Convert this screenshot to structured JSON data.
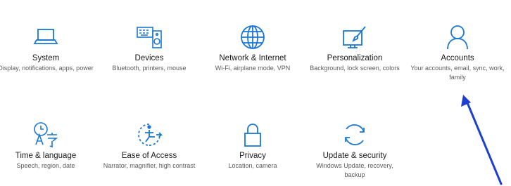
{
  "accent_color": "#1a78d2",
  "annotation_color": "#1f3fd0",
  "tiles": [
    {
      "icon": "laptop-icon",
      "title": "System",
      "desc": "Display, notifications, apps, power"
    },
    {
      "icon": "devices-icon",
      "title": "Devices",
      "desc": "Bluetooth, printers, mouse"
    },
    {
      "icon": "globe-icon",
      "title": "Network & Internet",
      "desc": "Wi-Fi, airplane mode, VPN"
    },
    {
      "icon": "personalization-icon",
      "title": "Personalization",
      "desc": "Background, lock screen, colors"
    },
    {
      "icon": "person-icon",
      "title": "Accounts",
      "desc": "Your accounts, email, sync, work, family"
    },
    {
      "icon": "time-language-icon",
      "title": "Time & language",
      "desc": "Speech, region, date"
    },
    {
      "icon": "ease-of-access-icon",
      "title": "Ease of Access",
      "desc": "Narrator, magnifier, high contrast"
    },
    {
      "icon": "lock-icon",
      "title": "Privacy",
      "desc": "Location, camera"
    },
    {
      "icon": "sync-icon",
      "title": "Update & security",
      "desc": "Windows Update, recovery, backup"
    }
  ]
}
